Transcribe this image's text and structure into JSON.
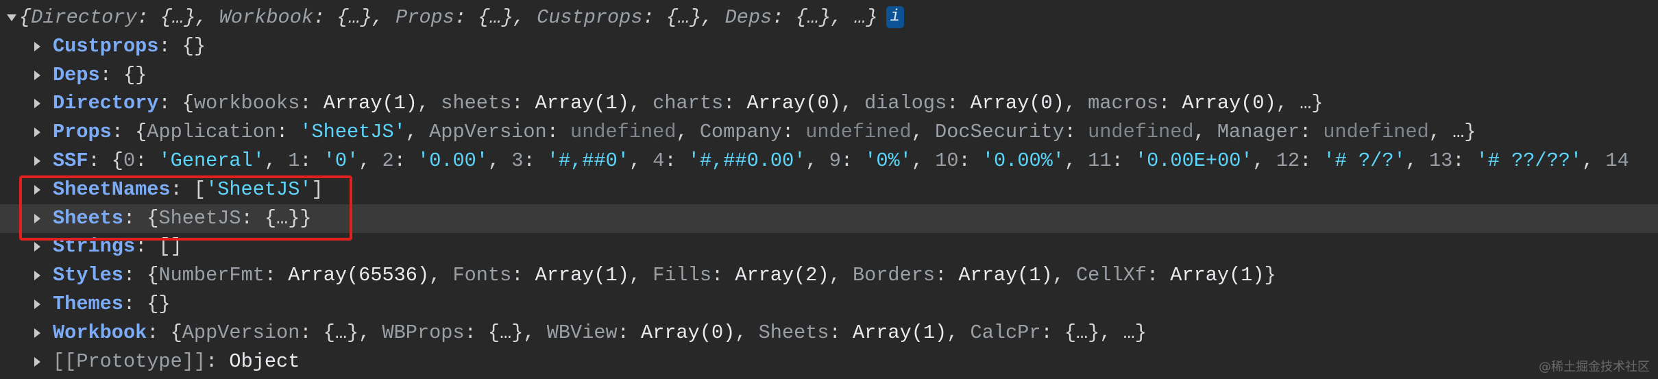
{
  "header": {
    "expanded": true,
    "segments": [
      {
        "t": "{",
        "c": "p i"
      },
      {
        "t": "Directory",
        "c": "g i"
      },
      {
        "t": ": {…}, ",
        "c": "p i"
      },
      {
        "t": "Workbook",
        "c": "g i"
      },
      {
        "t": ": {…}, ",
        "c": "p i"
      },
      {
        "t": "Props",
        "c": "g i"
      },
      {
        "t": ": {…}, ",
        "c": "p i"
      },
      {
        "t": "Custprops",
        "c": "g i"
      },
      {
        "t": ": {…}, ",
        "c": "p i"
      },
      {
        "t": "Deps",
        "c": "g i"
      },
      {
        "t": ": {…}, …}",
        "c": "p i"
      }
    ],
    "info_badge": "i"
  },
  "rows": [
    {
      "name": "Custprops",
      "segments": [
        {
          "t": "Custprops",
          "c": "k"
        },
        {
          "t": ": {}",
          "c": "p"
        }
      ]
    },
    {
      "name": "Deps",
      "segments": [
        {
          "t": "Deps",
          "c": "k"
        },
        {
          "t": ": {}",
          "c": "p"
        }
      ]
    },
    {
      "name": "Directory",
      "segments": [
        {
          "t": "Directory",
          "c": "k"
        },
        {
          "t": ": {",
          "c": "p"
        },
        {
          "t": "workbooks",
          "c": "g"
        },
        {
          "t": ": ",
          "c": "p"
        },
        {
          "t": "Array(1)",
          "c": "w"
        },
        {
          "t": ", ",
          "c": "p"
        },
        {
          "t": "sheets",
          "c": "g"
        },
        {
          "t": ": ",
          "c": "p"
        },
        {
          "t": "Array(1)",
          "c": "w"
        },
        {
          "t": ", ",
          "c": "p"
        },
        {
          "t": "charts",
          "c": "g"
        },
        {
          "t": ": ",
          "c": "p"
        },
        {
          "t": "Array(0)",
          "c": "w"
        },
        {
          "t": ", ",
          "c": "p"
        },
        {
          "t": "dialogs",
          "c": "g"
        },
        {
          "t": ": ",
          "c": "p"
        },
        {
          "t": "Array(0)",
          "c": "w"
        },
        {
          "t": ", ",
          "c": "p"
        },
        {
          "t": "macros",
          "c": "g"
        },
        {
          "t": ": ",
          "c": "p"
        },
        {
          "t": "Array(0)",
          "c": "w"
        },
        {
          "t": ", …}",
          "c": "p"
        }
      ]
    },
    {
      "name": "Props",
      "segments": [
        {
          "t": "Props",
          "c": "k"
        },
        {
          "t": ": {",
          "c": "p"
        },
        {
          "t": "Application",
          "c": "g"
        },
        {
          "t": ": ",
          "c": "p"
        },
        {
          "t": "'SheetJS'",
          "c": "s"
        },
        {
          "t": ", ",
          "c": "p"
        },
        {
          "t": "AppVersion",
          "c": "g"
        },
        {
          "t": ": ",
          "c": "p"
        },
        {
          "t": "undefined",
          "c": "u"
        },
        {
          "t": ", ",
          "c": "p"
        },
        {
          "t": "Company",
          "c": "g"
        },
        {
          "t": ": ",
          "c": "p"
        },
        {
          "t": "undefined",
          "c": "u"
        },
        {
          "t": ", ",
          "c": "p"
        },
        {
          "t": "DocSecurity",
          "c": "g"
        },
        {
          "t": ": ",
          "c": "p"
        },
        {
          "t": "undefined",
          "c": "u"
        },
        {
          "t": ", ",
          "c": "p"
        },
        {
          "t": "Manager",
          "c": "g"
        },
        {
          "t": ": ",
          "c": "p"
        },
        {
          "t": "undefined",
          "c": "u"
        },
        {
          "t": ", …}",
          "c": "p"
        }
      ]
    },
    {
      "name": "SSF",
      "segments": [
        {
          "t": "SSF",
          "c": "k"
        },
        {
          "t": ": {",
          "c": "p"
        },
        {
          "t": "0",
          "c": "g"
        },
        {
          "t": ": ",
          "c": "p"
        },
        {
          "t": "'General'",
          "c": "s"
        },
        {
          "t": ", ",
          "c": "p"
        },
        {
          "t": "1",
          "c": "g"
        },
        {
          "t": ": ",
          "c": "p"
        },
        {
          "t": "'0'",
          "c": "s"
        },
        {
          "t": ", ",
          "c": "p"
        },
        {
          "t": "2",
          "c": "g"
        },
        {
          "t": ": ",
          "c": "p"
        },
        {
          "t": "'0.00'",
          "c": "s"
        },
        {
          "t": ", ",
          "c": "p"
        },
        {
          "t": "3",
          "c": "g"
        },
        {
          "t": ": ",
          "c": "p"
        },
        {
          "t": "'#,##0'",
          "c": "s"
        },
        {
          "t": ", ",
          "c": "p"
        },
        {
          "t": "4",
          "c": "g"
        },
        {
          "t": ": ",
          "c": "p"
        },
        {
          "t": "'#,##0.00'",
          "c": "s"
        },
        {
          "t": ", ",
          "c": "p"
        },
        {
          "t": "9",
          "c": "g"
        },
        {
          "t": ": ",
          "c": "p"
        },
        {
          "t": "'0%'",
          "c": "s"
        },
        {
          "t": ", ",
          "c": "p"
        },
        {
          "t": "10",
          "c": "g"
        },
        {
          "t": ": ",
          "c": "p"
        },
        {
          "t": "'0.00%'",
          "c": "s"
        },
        {
          "t": ", ",
          "c": "p"
        },
        {
          "t": "11",
          "c": "g"
        },
        {
          "t": ": ",
          "c": "p"
        },
        {
          "t": "'0.00E+00'",
          "c": "s"
        },
        {
          "t": ", ",
          "c": "p"
        },
        {
          "t": "12",
          "c": "g"
        },
        {
          "t": ": ",
          "c": "p"
        },
        {
          "t": "'# ?/?'",
          "c": "s"
        },
        {
          "t": ", ",
          "c": "p"
        },
        {
          "t": "13",
          "c": "g"
        },
        {
          "t": ": ",
          "c": "p"
        },
        {
          "t": "'# ??/??'",
          "c": "s"
        },
        {
          "t": ", ",
          "c": "p"
        },
        {
          "t": "14",
          "c": "g"
        }
      ]
    },
    {
      "name": "SheetNames",
      "segments": [
        {
          "t": "SheetNames",
          "c": "k"
        },
        {
          "t": ": [",
          "c": "p"
        },
        {
          "t": "'SheetJS'",
          "c": "s"
        },
        {
          "t": "]",
          "c": "p"
        }
      ]
    },
    {
      "name": "Sheets",
      "highlighted": true,
      "segments": [
        {
          "t": "Sheets",
          "c": "k"
        },
        {
          "t": ": {",
          "c": "p"
        },
        {
          "t": "SheetJS",
          "c": "g"
        },
        {
          "t": ": {…}}",
          "c": "p"
        }
      ]
    },
    {
      "name": "Strings",
      "segments": [
        {
          "t": "Strings",
          "c": "k"
        },
        {
          "t": ": []",
          "c": "p"
        }
      ]
    },
    {
      "name": "Styles",
      "segments": [
        {
          "t": "Styles",
          "c": "k"
        },
        {
          "t": ": {",
          "c": "p"
        },
        {
          "t": "NumberFmt",
          "c": "g"
        },
        {
          "t": ": ",
          "c": "p"
        },
        {
          "t": "Array(65536)",
          "c": "w"
        },
        {
          "t": ", ",
          "c": "p"
        },
        {
          "t": "Fonts",
          "c": "g"
        },
        {
          "t": ": ",
          "c": "p"
        },
        {
          "t": "Array(1)",
          "c": "w"
        },
        {
          "t": ", ",
          "c": "p"
        },
        {
          "t": "Fills",
          "c": "g"
        },
        {
          "t": ": ",
          "c": "p"
        },
        {
          "t": "Array(2)",
          "c": "w"
        },
        {
          "t": ", ",
          "c": "p"
        },
        {
          "t": "Borders",
          "c": "g"
        },
        {
          "t": ": ",
          "c": "p"
        },
        {
          "t": "Array(1)",
          "c": "w"
        },
        {
          "t": ", ",
          "c": "p"
        },
        {
          "t": "CellXf",
          "c": "g"
        },
        {
          "t": ": ",
          "c": "p"
        },
        {
          "t": "Array(1)",
          "c": "w"
        },
        {
          "t": "}",
          "c": "p"
        }
      ]
    },
    {
      "name": "Themes",
      "segments": [
        {
          "t": "Themes",
          "c": "k"
        },
        {
          "t": ": {}",
          "c": "p"
        }
      ]
    },
    {
      "name": "Workbook",
      "segments": [
        {
          "t": "Workbook",
          "c": "k"
        },
        {
          "t": ": {",
          "c": "p"
        },
        {
          "t": "AppVersion",
          "c": "g"
        },
        {
          "t": ": {…}, ",
          "c": "p"
        },
        {
          "t": "WBProps",
          "c": "g"
        },
        {
          "t": ": {…}, ",
          "c": "p"
        },
        {
          "t": "WBView",
          "c": "g"
        },
        {
          "t": ": ",
          "c": "p"
        },
        {
          "t": "Array(0)",
          "c": "w"
        },
        {
          "t": ", ",
          "c": "p"
        },
        {
          "t": "Sheets",
          "c": "g"
        },
        {
          "t": ": ",
          "c": "p"
        },
        {
          "t": "Array(1)",
          "c": "w"
        },
        {
          "t": ", ",
          "c": "p"
        },
        {
          "t": "CalcPr",
          "c": "g"
        },
        {
          "t": ": {…}, …}",
          "c": "p"
        }
      ]
    },
    {
      "name": "Prototype",
      "segments": [
        {
          "t": "[[Prototype]]",
          "c": "g"
        },
        {
          "t": ": ",
          "c": "p"
        },
        {
          "t": "Object",
          "c": "w"
        }
      ]
    }
  ],
  "colors": {
    "background": "#282828",
    "key": "#7cacf8",
    "string": "#5cd5fb",
    "highlight_box": "#e0201e",
    "row_highlight": "#3a3a3a"
  },
  "watermark": "@稀土掘金技术社区"
}
